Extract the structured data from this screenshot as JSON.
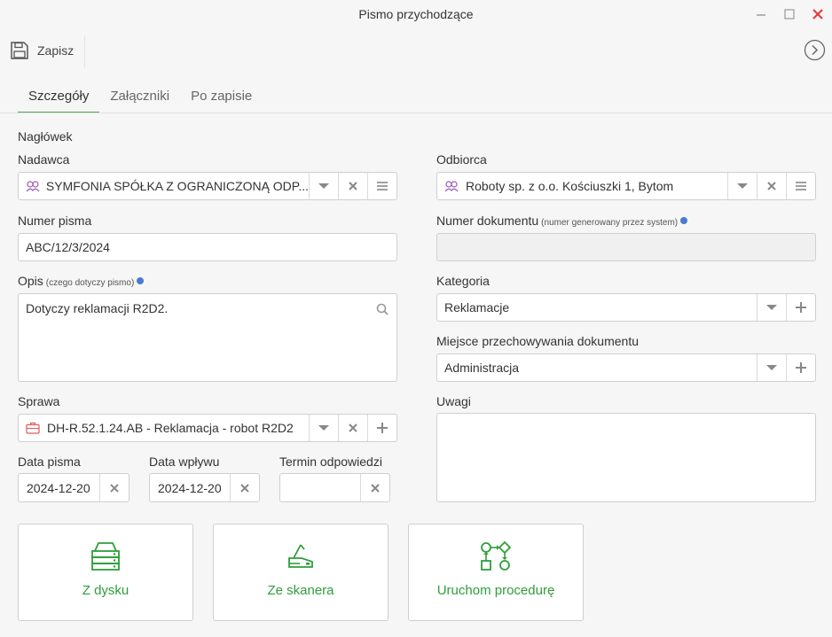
{
  "window": {
    "title": "Pismo przychodzące"
  },
  "toolbar": {
    "save_label": "Zapisz"
  },
  "tabs": [
    {
      "label": "Szczegóły",
      "active": true
    },
    {
      "label": "Załączniki",
      "active": false
    },
    {
      "label": "Po zapisie",
      "active": false
    }
  ],
  "section": {
    "title": "Nagłówek"
  },
  "form": {
    "nadawca": {
      "label": "Nadawca",
      "value": "SYMFONIA SPÓŁKA Z OGRANICZONĄ ODP..."
    },
    "odbiorca": {
      "label": "Odbiorca",
      "value": "Roboty sp. z o.o. Kościuszki 1, Bytom"
    },
    "numer_pisma": {
      "label": "Numer pisma",
      "value": "ABC/12/3/2024"
    },
    "numer_dokumentu": {
      "label": "Numer dokumentu",
      "hint": "(numer generowany przez system)",
      "value": ""
    },
    "opis": {
      "label": "Opis",
      "hint": "(czego dotyczy pismo)",
      "value": "Dotyczy reklamacji R2D2."
    },
    "kategoria": {
      "label": "Kategoria",
      "value": "Reklamacje"
    },
    "miejsce": {
      "label": "Miejsce przechowywania dokumentu",
      "value": "Administracja"
    },
    "sprawa": {
      "label": "Sprawa",
      "value": "DH-R.52.1.24.AB - Reklamacja - robot R2D2"
    },
    "uwagi": {
      "label": "Uwagi",
      "value": ""
    },
    "data_pisma": {
      "label": "Data pisma",
      "value": "2024-12-20"
    },
    "data_wplywu": {
      "label": "Data wpływu",
      "value": "2024-12-20"
    },
    "termin": {
      "label": "Termin odpowiedzi",
      "value": ""
    }
  },
  "actions": [
    {
      "label": "Z dysku",
      "icon": "disk-drive-icon"
    },
    {
      "label": "Ze skanera",
      "icon": "scanner-icon"
    },
    {
      "label": "Uruchom procedurę",
      "icon": "workflow-icon"
    }
  ],
  "colors": {
    "accent": "#4caf50",
    "action_text": "#2e9e3a",
    "close": "#e53935"
  }
}
